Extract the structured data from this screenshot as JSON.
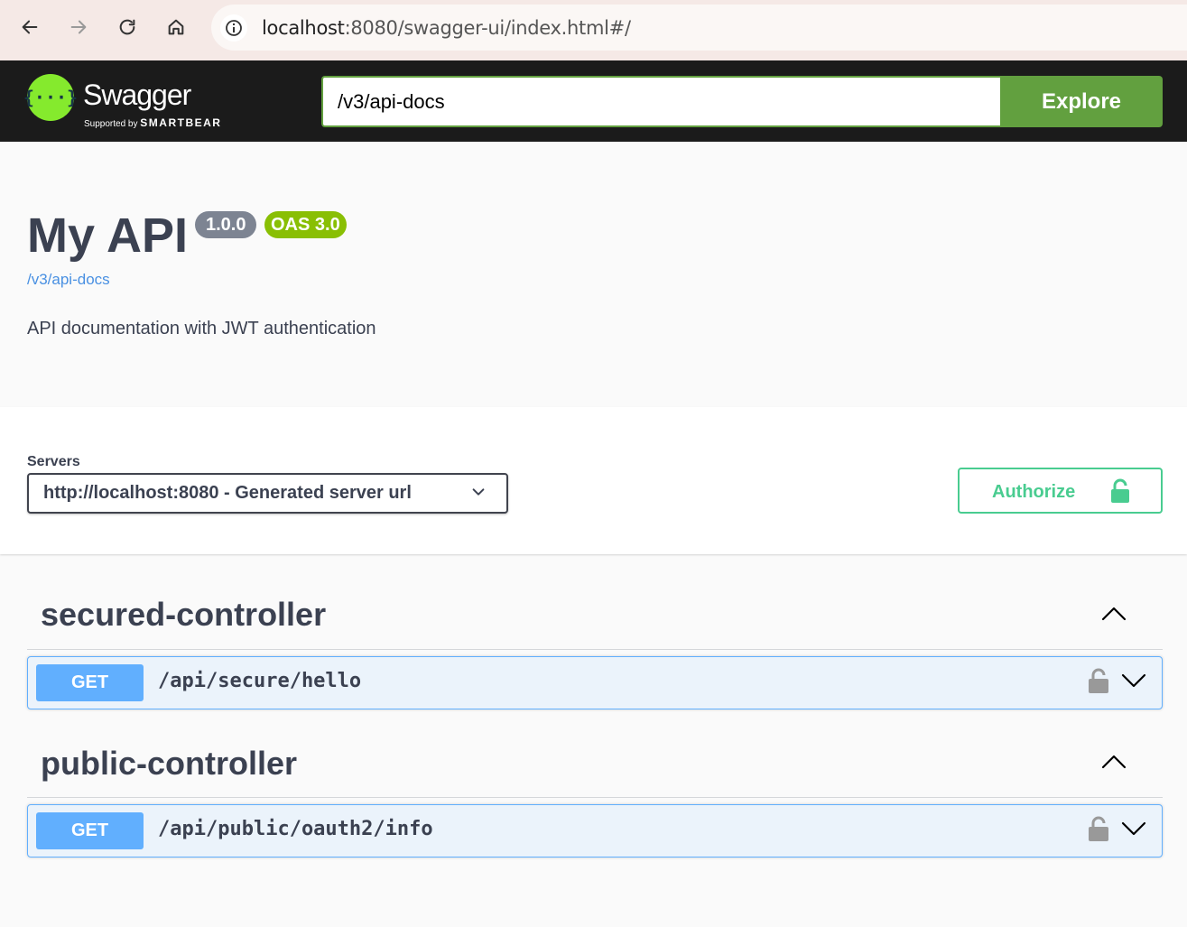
{
  "browser": {
    "url_host": "localhost",
    "url_rest": ":8080/swagger-ui/index.html#/"
  },
  "topbar": {
    "logo_text": "Swagger",
    "logo_sub_prefix": "Supported by",
    "logo_sub_brand": "SMARTBEAR",
    "explore_input_value": "/v3/api-docs",
    "explore_button": "Explore"
  },
  "info": {
    "title": "My API",
    "version": "1.0.0",
    "oas": "OAS 3.0",
    "spec_link": "/v3/api-docs",
    "description": "API documentation with JWT authentication"
  },
  "servers": {
    "label": "Servers",
    "selected": "http://localhost:8080 - Generated server url"
  },
  "authorize": {
    "label": "Authorize"
  },
  "tags": [
    {
      "name": "secured-controller",
      "operations": [
        {
          "method": "GET",
          "path": "/api/secure/hello"
        }
      ]
    },
    {
      "name": "public-controller",
      "operations": [
        {
          "method": "GET",
          "path": "/api/public/oauth2/info"
        }
      ]
    }
  ],
  "colors": {
    "get": "#61affe",
    "explore": "#62a03f",
    "authorize": "#49cc90",
    "oas_badge": "#89bf04"
  }
}
